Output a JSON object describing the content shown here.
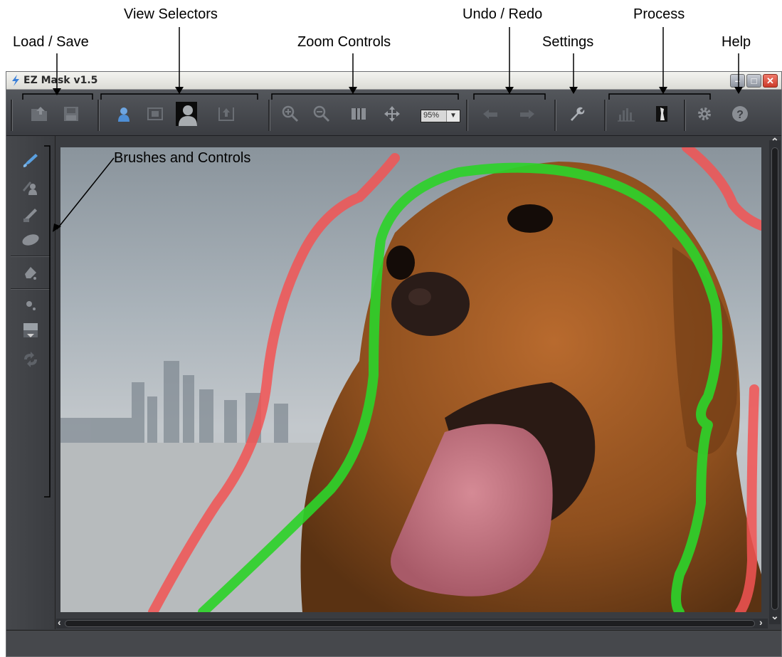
{
  "callouts": {
    "load_save": "Load / Save",
    "view_selectors": "View Selectors",
    "zoom_controls": "Zoom Controls",
    "undo_redo": "Undo / Redo",
    "settings": "Settings",
    "process": "Process",
    "help": "Help",
    "brushes": "Brushes and Controls"
  },
  "window": {
    "title": "EZ Mask v1.5",
    "minimize": "–",
    "maximize": "□",
    "close": "✕"
  },
  "toolbar": {
    "zoom_value": "95%",
    "zoom_arrow": "▼",
    "icons": [
      "open-icon",
      "save-icon",
      "foreground-view-icon",
      "mask-view-icon",
      "silhouette-view-icon",
      "export-view-icon",
      "zoom-in-icon",
      "zoom-out-icon",
      "fit-icon",
      "pan-icon",
      "undo-icon",
      "redo-icon",
      "wrench-icon",
      "histogram-icon",
      "process-icon",
      "gear-icon",
      "help-icon"
    ]
  },
  "sidebar": {
    "icons": [
      "keep-brush-icon",
      "drop-brush-icon",
      "detail-brush-icon",
      "eraser-icon",
      "fill-icon",
      "brush-size-icon",
      "view-mask-icon",
      "refresh-icon"
    ]
  },
  "scroll": {
    "up": "⌃",
    "down": "⌄",
    "left": "‹",
    "right": "›"
  },
  "colors": {
    "keep_stroke": "#2ed12a",
    "drop_stroke": "#f25353",
    "toolbar_bg": "#44474c",
    "accent_blue": "#5aa0e0"
  }
}
